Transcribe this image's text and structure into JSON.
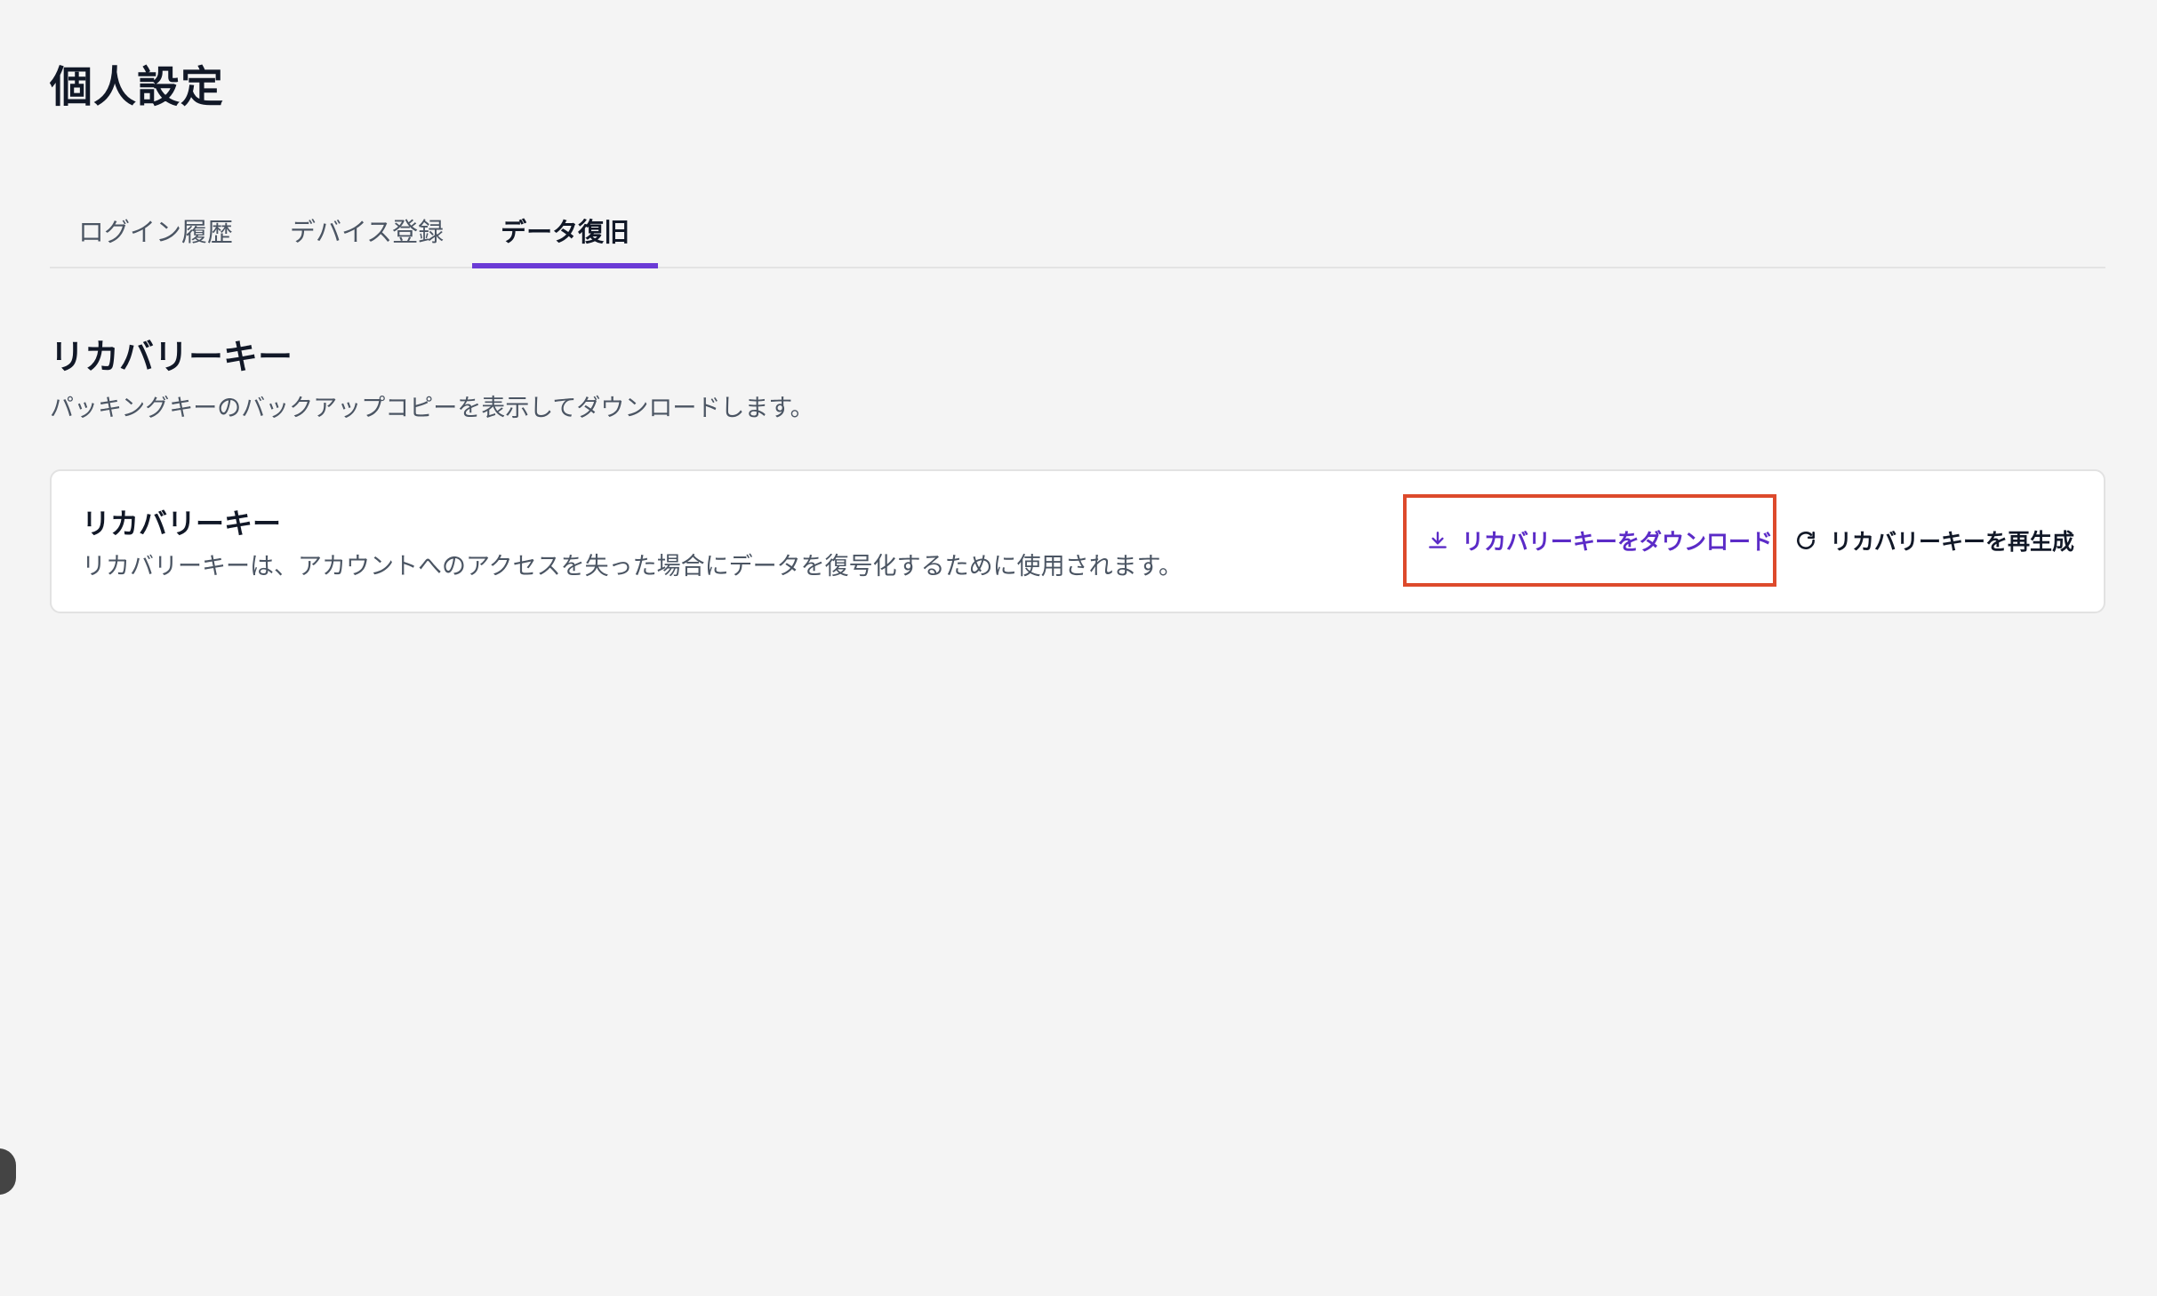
{
  "page": {
    "title": "個人設定"
  },
  "tabs": [
    {
      "label": "ログイン履歴",
      "active": false
    },
    {
      "label": "デバイス登録",
      "active": false
    },
    {
      "label": "データ復旧",
      "active": true
    }
  ],
  "section": {
    "title": "リカバリーキー",
    "description": "パッキングキーのバックアップコピーを表示してダウンロードします。"
  },
  "card": {
    "title": "リカバリーキー",
    "description": "リカバリーキーは、アカウントへのアクセスを失った場合にデータを復号化するために使用されます。",
    "download_button": {
      "label": "リカバリーキーをダウンロード",
      "icon": "download-icon"
    },
    "regenerate_button": {
      "label": "リカバリーキーを再生成",
      "icon": "refresh-icon"
    }
  },
  "colors": {
    "accent": "#6b3bd6",
    "download_text": "#5b2bc7",
    "highlight_box": "#dd4a2c",
    "background": "#f4f4f4"
  }
}
